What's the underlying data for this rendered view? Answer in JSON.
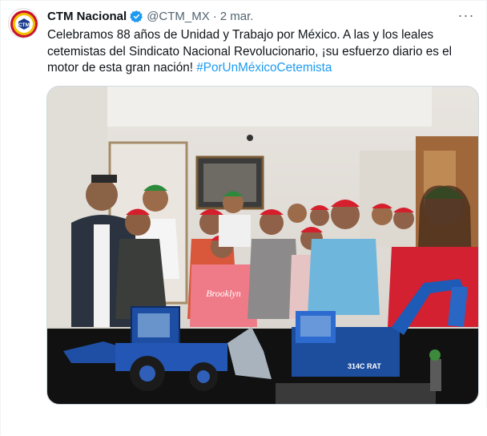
{
  "tweet": {
    "author_name": "CTM Nacional",
    "handle": "@CTM_MX",
    "separator": "·",
    "date": "2 mar.",
    "text_main": "Celebramos 88 años de Unidad y Trabajo por México. A las y los leales cetemistas del Sindicato Nacional Revolucionario, ¡su esfuerzo diario es el motor de esta gran nación! ",
    "hashtag": "#PorUnMéxicoCetemista",
    "more_label": "···"
  },
  "avatar": {
    "logo_text": "CTM"
  },
  "media": {
    "shirt_text": "Brooklyn",
    "excavator_text": "314C RAT"
  },
  "colors": {
    "link": "#1d9bf0",
    "verified": "#1d9bf0",
    "muted": "#536471"
  }
}
